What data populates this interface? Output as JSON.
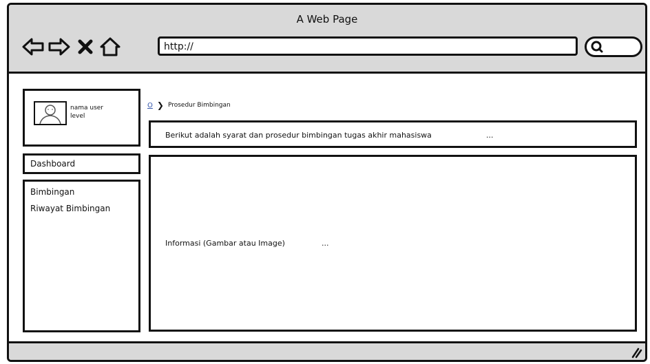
{
  "window": {
    "title": "A Web Page"
  },
  "toolbar": {
    "back_icon": "back-arrow-icon",
    "forward_icon": "forward-arrow-icon",
    "stop_icon": "close-icon",
    "home_icon": "home-icon",
    "url": "http://",
    "search_icon": "search-icon"
  },
  "profile": {
    "name": "nama user",
    "level": "level",
    "avatar_icon": "user-avatar-icon"
  },
  "sidebar": {
    "dashboard": "Dashboard",
    "items": [
      {
        "label": "Bimbingan"
      },
      {
        "label": "Riwayat Bimbingan"
      }
    ]
  },
  "breadcrumb": {
    "home": "O",
    "current": "Prosedur Bimbingan"
  },
  "notice": {
    "text": "Berikut adalah syarat dan prosedur bimbingan tugas akhir mahasiswa",
    "ellipsis": "..."
  },
  "content": {
    "text": "Informasi (Gambar atau Image)",
    "ellipsis": "..."
  },
  "colors": {
    "chrome": "#d9d9d9",
    "border": "#111111",
    "link": "#3355aa"
  }
}
